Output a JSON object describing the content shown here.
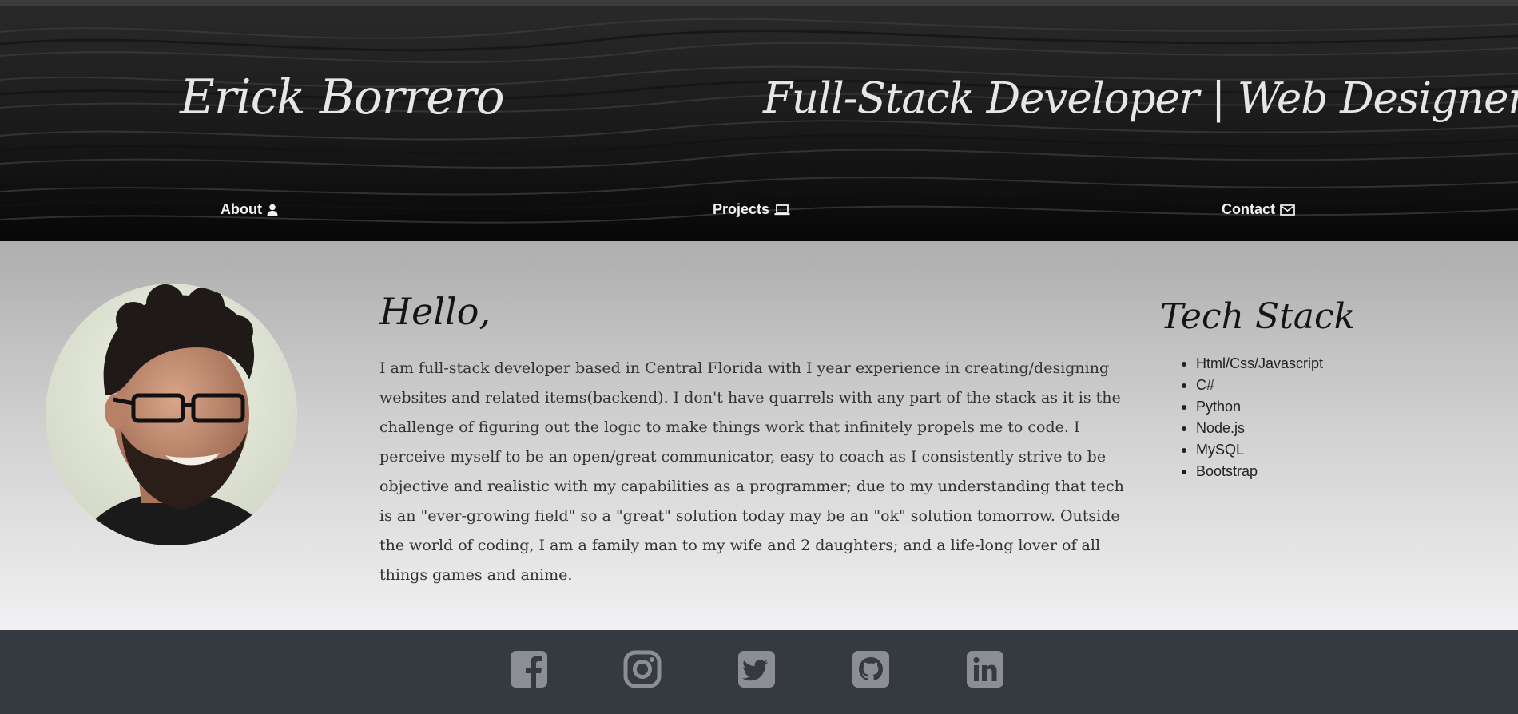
{
  "header": {
    "name": "Erick Borrero",
    "tagline": "Full-Stack Developer | Web Designer",
    "nav": [
      {
        "label": "About",
        "icon": "user-icon"
      },
      {
        "label": "Projects",
        "icon": "laptop-icon"
      },
      {
        "label": "Contact",
        "icon": "envelope-icon"
      }
    ]
  },
  "about": {
    "greeting": "Hello,",
    "text": "I am full-stack developer based in Central Florida with I year experience in creating/designing websites and related items(backend). I don't have quarrels with any part of the stack as it is the challenge of figuring out the logic to make things work that infinitely propels me to code. I perceive myself to be an open/great communicator, easy to coach as I consistently strive to be objective and realistic with my capabilities as a programmer; due to my understanding that tech is an \"ever-growing field\" so a \"great\" solution today may be an \"ok\" solution tomorrow. Outside the world of coding, I am a family man to my wife and 2 daughters; and a life-long lover of all things games and anime."
  },
  "tech_stack": {
    "title": "Tech Stack",
    "items": [
      "Html/Css/Javascript",
      "C#",
      "Python",
      "Node.js",
      "MySQL",
      "Bootstrap"
    ]
  },
  "footer": {
    "social": [
      "facebook-icon",
      "instagram-icon",
      "twitter-icon",
      "github-icon",
      "linkedin-icon"
    ]
  },
  "colors": {
    "header_bg": "#0b0b0b",
    "header_text": "#e6e6e6",
    "footer_bg": "#343a40",
    "social_icon": "#8b8e92"
  }
}
